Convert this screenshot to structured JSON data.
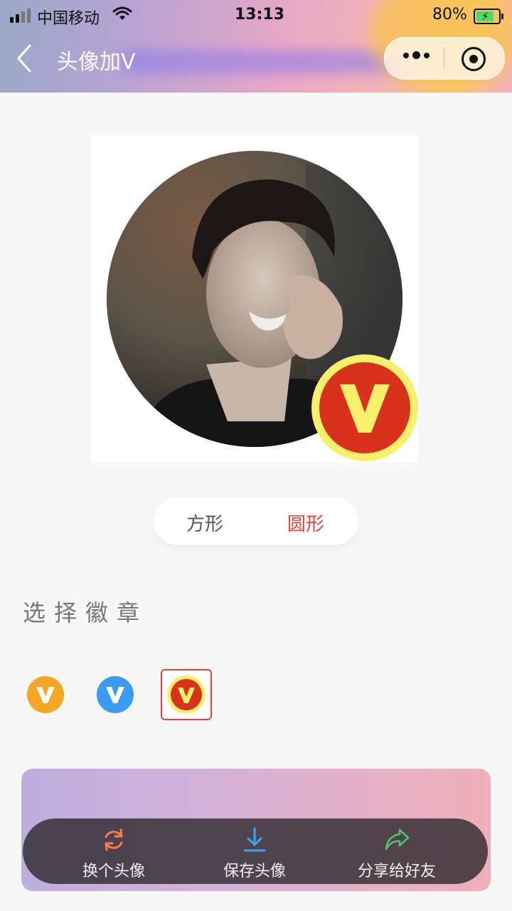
{
  "status_bar": {
    "carrier": "中国移动",
    "time": "13:13",
    "battery": "80%"
  },
  "nav": {
    "title": "头像加V"
  },
  "shape_toggle": {
    "options": [
      "方形",
      "圆形"
    ],
    "selected": "圆形"
  },
  "badge_section": {
    "title": "选择徽章",
    "selected_index": 2
  },
  "actions": {
    "change": "换个头像",
    "save": "保存头像",
    "share": "分享给好友"
  },
  "colors": {
    "accent": "#e0403a",
    "badge_orange": "#f6a623",
    "badge_blue": "#3b9bf0",
    "badge_red": "#d8321c",
    "badge_ring": "#f7f06a"
  }
}
